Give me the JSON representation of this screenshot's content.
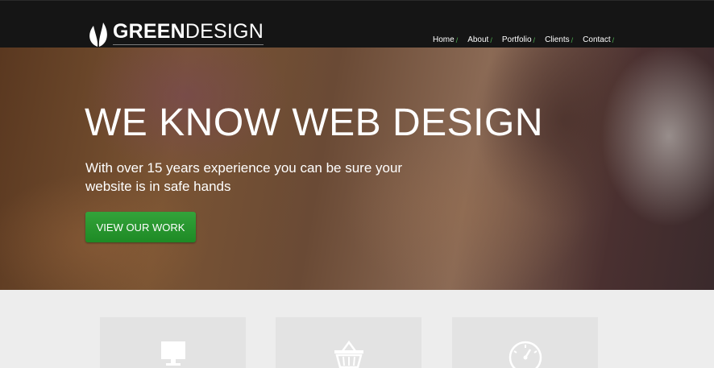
{
  "brand": {
    "name_bold": "GREEN",
    "name_rest": "DESIGN"
  },
  "nav": {
    "items": [
      {
        "label": "Home"
      },
      {
        "label": "About"
      },
      {
        "label": "Portfolio"
      },
      {
        "label": "Clients"
      },
      {
        "label": "Contact"
      }
    ],
    "separator": "/"
  },
  "hero": {
    "title": "WE KNOW WEB DESIGN",
    "subtitle": "With over 15 years experience you can be sure your website is in safe hands",
    "cta_label": "VIEW OUR WORK"
  },
  "features": [
    {
      "icon": "monitor-icon"
    },
    {
      "icon": "basket-icon"
    },
    {
      "icon": "speedometer-icon"
    }
  ],
  "colors": {
    "header_bg": "#151515",
    "accent": "#2a9b31",
    "feature_bg": "#e3e3e3"
  }
}
